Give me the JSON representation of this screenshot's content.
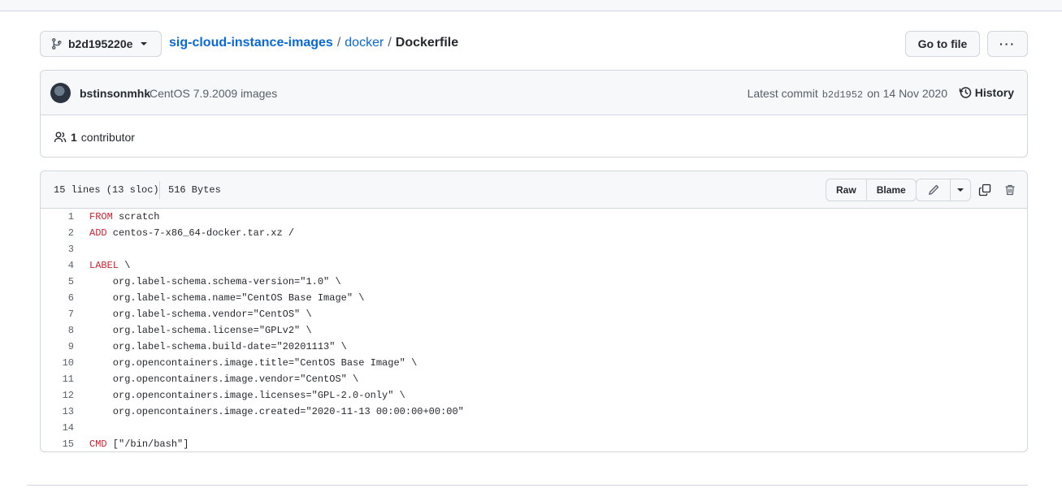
{
  "branch": {
    "name": "b2d195220e"
  },
  "breadcrumb": {
    "repo": "sig-cloud-instance-images",
    "sep1": "/",
    "dir": "docker",
    "sep2": "/",
    "file": "Dockerfile"
  },
  "actions": {
    "goto_label": "Go to file",
    "more_label": "···"
  },
  "commit": {
    "author": "bstinsonmhk",
    "message": "CentOS 7.9.2009 images",
    "latest_prefix": "Latest commit",
    "sha": "b2d1952",
    "date_text": "on 14 Nov 2020",
    "history_label": "History"
  },
  "contributors": {
    "count": "1",
    "label": "contributor"
  },
  "file": {
    "lines_info": "15 lines (13 sloc)",
    "size_info": "516 Bytes",
    "raw_label": "Raw",
    "blame_label": "Blame"
  },
  "code_lines": [
    {
      "n": "1",
      "kw": "FROM",
      "rest": " scratch"
    },
    {
      "n": "2",
      "kw": "ADD",
      "rest": " centos-7-x86_64-docker.tar.xz /"
    },
    {
      "n": "3",
      "kw": "",
      "rest": ""
    },
    {
      "n": "4",
      "kw": "LABEL",
      "rest": " \\"
    },
    {
      "n": "5",
      "kw": "",
      "rest": "    org.label-schema.schema-version=\"1.0\" \\"
    },
    {
      "n": "6",
      "kw": "",
      "rest": "    org.label-schema.name=\"CentOS Base Image\" \\"
    },
    {
      "n": "7",
      "kw": "",
      "rest": "    org.label-schema.vendor=\"CentOS\" \\"
    },
    {
      "n": "8",
      "kw": "",
      "rest": "    org.label-schema.license=\"GPLv2\" \\"
    },
    {
      "n": "9",
      "kw": "",
      "rest": "    org.label-schema.build-date=\"20201113\" \\"
    },
    {
      "n": "10",
      "kw": "",
      "rest": "    org.opencontainers.image.title=\"CentOS Base Image\" \\"
    },
    {
      "n": "11",
      "kw": "",
      "rest": "    org.opencontainers.image.vendor=\"CentOS\" \\"
    },
    {
      "n": "12",
      "kw": "",
      "rest": "    org.opencontainers.image.licenses=\"GPL-2.0-only\" \\"
    },
    {
      "n": "13",
      "kw": "",
      "rest": "    org.opencontainers.image.created=\"2020-11-13 00:00:00+00:00\""
    },
    {
      "n": "14",
      "kw": "",
      "rest": ""
    },
    {
      "n": "15",
      "kw": "CMD",
      "rest": " [\"/bin/bash\"]"
    }
  ],
  "colors": {
    "link": "#0969da",
    "keyword": "#cf222e",
    "border": "#d0d7de",
    "header_bg": "#f6f8fa"
  }
}
